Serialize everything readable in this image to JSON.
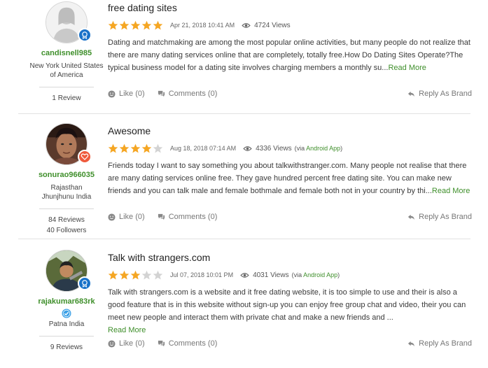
{
  "colors": {
    "star_on": "#f5a623",
    "star_off": "#d3d3d3",
    "accent_green": "#3f8f2b"
  },
  "reviews": [
    {
      "title": "free dating sites",
      "rating": 5,
      "date": "Apr 21, 2018 10:41 AM",
      "views": "4724 Views",
      "via_prefix": "",
      "via_app": "",
      "via_suffix": "",
      "body": "Dating and matchmaking are among the most popular online activities, but many people do not realize that there are many dating services online that are completely, totally free.How Do Dating Sites Operate?The typical business model for a dating site involves charging members a monthly su...",
      "read_more": "Read More",
      "like": "Like (0)",
      "comments": "Comments (0)",
      "reply": "Reply As Brand",
      "user": {
        "name": "candisnell985",
        "location": "New York United States of America",
        "stat1": "1 Review",
        "stat2": "",
        "avatar_icon": "default-user-avatar",
        "badge_icon": "medal-icon"
      }
    },
    {
      "title": "Awesome",
      "rating": 4,
      "date": "Aug 18, 2018 07:14 AM",
      "views": "4336 Views",
      "via_prefix": "(via ",
      "via_app": "Android App",
      "via_suffix": ")",
      "body": "Friends today I want to say something you about talkwithstranger.com. Many people not realise that there are many dating services online free. They gave hundred percent free dating site. You can make new friends and you can talk male and female bothmale and female both not in your country by thi...",
      "read_more": "Read More",
      "like": "Like (0)",
      "comments": "Comments (0)",
      "reply": "Reply As Brand",
      "user": {
        "name": "sonurao966035",
        "location": "Rajasthan Jhunjhunu India",
        "stat1": "84 Reviews",
        "stat2": "40 Followers",
        "avatar_icon": "user-photo",
        "badge_icon": "heart-icon"
      }
    },
    {
      "title": "Talk with strangers.com",
      "rating": 3,
      "date": "Jul 07, 2018 10:01 PM",
      "views": "4031 Views",
      "via_prefix": "(via ",
      "via_app": "Android App",
      "via_suffix": ")",
      "body": "Talk with strangers.com is a website and it free dating website, it is too simple to use and their is also a good feature that is in this website without sign-up you can enjoy free group chat and video, their you can meet new people and interact them with private chat and make a new friends and ...",
      "read_more": "Read More",
      "like": "Like (0)",
      "comments": "Comments (0)",
      "reply": "Reply As Brand",
      "user": {
        "name": "rajakumar683rk",
        "location": "Patna India",
        "stat1": "9 Reviews",
        "stat2": "",
        "avatar_icon": "user-photo",
        "badge_icon": "medal-icon",
        "verified_icon": "verified-check-icon"
      }
    }
  ]
}
